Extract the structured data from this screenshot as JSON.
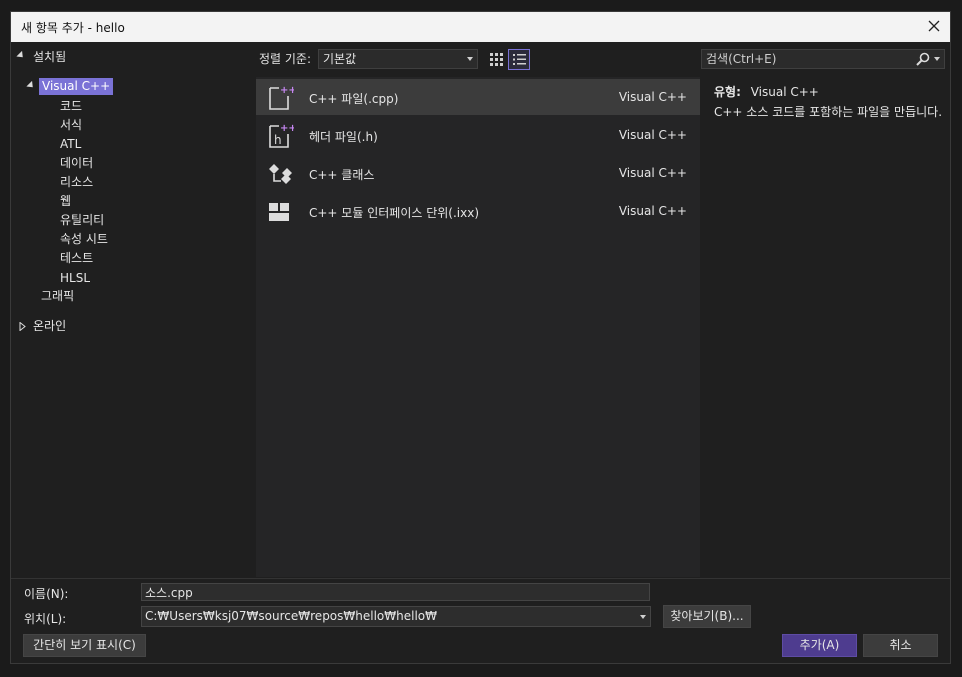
{
  "window": {
    "title": "새 항목 추가 - hello"
  },
  "tree": {
    "installed": "설치됨",
    "visual_cpp": "Visual C++",
    "children": [
      "코드",
      "서식",
      "ATL",
      "데이터",
      "리소스",
      "웹",
      "유틸리티",
      "속성 시트",
      "테스트",
      "HLSL"
    ],
    "graphics": "그래픽",
    "online": "온라인"
  },
  "toolbar": {
    "sort_label": "정렬 기준:",
    "sort_value": "기본값"
  },
  "templates": [
    {
      "name": "C++ 파일(.cpp)",
      "type": "Visual C++",
      "icon": "cpp-file-icon"
    },
    {
      "name": "헤더 파일(.h)",
      "type": "Visual C++",
      "icon": "header-file-icon"
    },
    {
      "name": "C++ 클래스",
      "type": "Visual C++",
      "icon": "class-icon"
    },
    {
      "name": "C++ 모듈 인터페이스 단위(.ixx)",
      "type": "Visual C++",
      "icon": "module-icon"
    }
  ],
  "search": {
    "placeholder": "검색(Ctrl+E)"
  },
  "description": {
    "type_label": "유형:",
    "type_value": "Visual C++",
    "text": "C++ 소스 코드를 포함하는 파일을 만듭니다."
  },
  "bottom": {
    "name_label": "이름(N):",
    "name_value": "소스.cpp",
    "location_label": "위치(L):",
    "location_value": "C:₩Users₩ksj07₩source₩repos₩hello₩hello₩",
    "browse_label": "찾아보기(B)...",
    "compact_label": "간단히 보기 표시(C)",
    "add_label": "추가(A)",
    "cancel_label": "취소"
  },
  "colors": {
    "accent": "#7a72d6",
    "primary_button": "#4e3c8f"
  }
}
